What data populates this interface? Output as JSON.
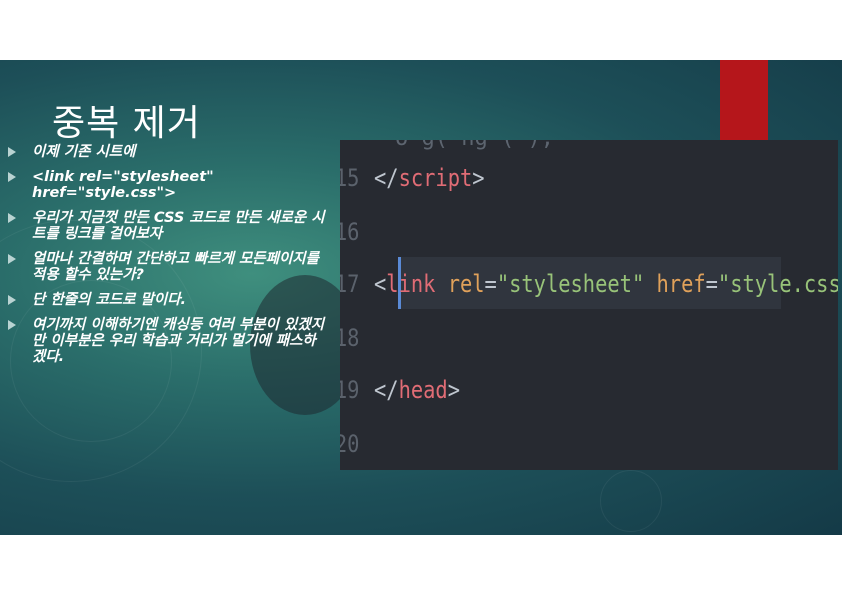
{
  "slide": {
    "title": "중복 제거",
    "bullets": [
      "이제 기존 시트에",
      "<link rel=\"stylesheet\" href=\"style.css\">",
      "우리가 지금껏 만든 CSS 코드로 만든 새로운 시트를 링크를 걸어보자",
      "얼마나 간결하며 간단하고 빠르게 모든페이지를 적용 할수 있는가?",
      "단 한줄의 코드로 말이다.",
      "여기까지 이해하기엔 캐싱등 여러 부분이 있겠지만 이부분은 우리 학습과 거리가 멀기에 패스하겠다."
    ]
  },
  "code": {
    "top_fragment": "o g( ng (            );",
    "lines": [
      {
        "num": "15",
        "close_open": "</",
        "tag": "script",
        "close_end": ">"
      },
      {
        "num": "16"
      },
      {
        "num": "17",
        "open": "<",
        "tag": "link",
        "attr1": "rel",
        "eq": "=",
        "val1": "\"stylesheet\"",
        "attr2": "href",
        "val2": "\"style.css\"",
        "end": ">"
      },
      {
        "num": "18"
      },
      {
        "num": "19",
        "close_open": "</",
        "tag": "head",
        "close_end": ">"
      },
      {
        "num": "20"
      }
    ]
  },
  "colors": {
    "red_accent": "#b5161b",
    "code_bg": "#272a31",
    "tag": "#e06c75",
    "attr": "#e0a15a",
    "string": "#98c379"
  }
}
